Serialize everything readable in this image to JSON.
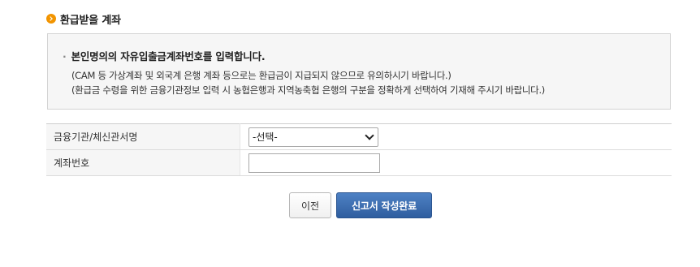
{
  "section": {
    "icon": "orange-circle-chevron-icon",
    "title": "환급받을 계좌"
  },
  "notice": {
    "bullet": "·",
    "heading": "본인명의의 자유입출금계좌번호를 입력합니다.",
    "lines": [
      "(CAM 등 가상계좌 및 외국계 은행 계좌 등으로는 환급금이 지급되지 않으므로 유의하시기 바랍니다.)",
      "(환급금 수령을 위한 금융기관정보 입력 시 농협은행과 지역농축협 은행의 구분을 정확하게 선택하여 기재해 주시기 바랍니다.)"
    ]
  },
  "form": {
    "bank_label": "금융기관/체신관서명",
    "bank_select_value": "-선택-",
    "account_label": "계좌번호",
    "account_value": ""
  },
  "buttons": {
    "prev_label": "이전",
    "submit_label": "신고서 작성완료"
  },
  "colors": {
    "accent_icon": "#f29400",
    "primary_button": "#3a6bb0"
  }
}
